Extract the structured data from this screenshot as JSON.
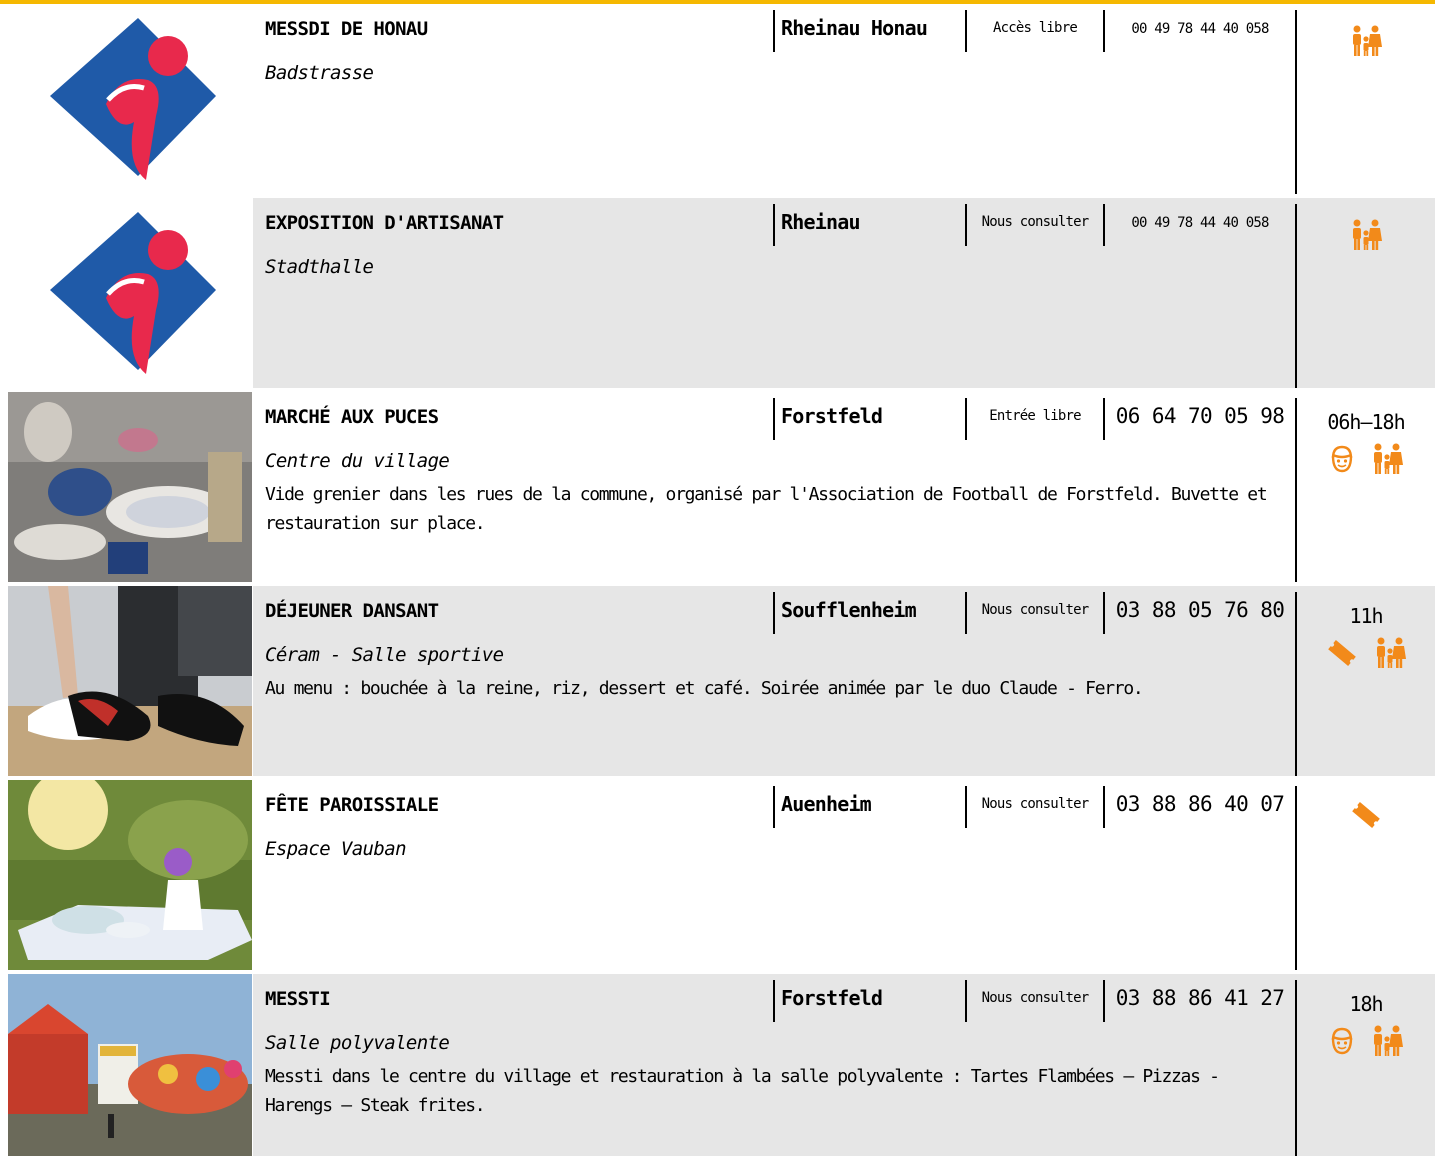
{
  "accent_color": "#f5b800",
  "icon_color": "#f28a1a",
  "events": [
    {
      "title": "MESSDI DE HONAU",
      "place": "Badstrasse",
      "city": "Rheinau Honau",
      "price": "Accès libre",
      "phone": "00 49 78 44 40 058",
      "time": "",
      "description": "",
      "image": "tourist-office-logo",
      "icons": [
        "family-icon"
      ]
    },
    {
      "title": "EXPOSITION D'ARTISANAT",
      "place": "Stadthalle",
      "city": "Rheinau",
      "price": "Nous consulter",
      "phone": "00 49 78 44 40 058",
      "time": "",
      "description": "",
      "image": "tourist-office-logo",
      "icons": [
        "family-icon"
      ]
    },
    {
      "title": "MARCHÉ AUX PUCES",
      "place": "Centre du village",
      "city": "Forstfeld",
      "price": "Entrée libre",
      "phone": "06 64 70 05 98",
      "time": "06h–18h",
      "description": "Vide grenier dans les rues de la commune, organisé par l'Association de Football de Forstfeld. Buvette et restauration sur place.",
      "image": "flea-market-photo",
      "icons": [
        "child-icon",
        "family-icon"
      ]
    },
    {
      "title": "DÉJEUNER DANSANT",
      "place": "Céram - Salle sportive",
      "city": "Soufflenheim",
      "price": "Nous consulter",
      "phone": "03 88 05 76 80",
      "time": "11h",
      "description": "Au menu : bouchée à la reine, riz, dessert et café. Soirée animée par le duo Claude - Ferro.",
      "image": "dance-shoes-photo",
      "icons": [
        "ticket-icon",
        "family-icon"
      ]
    },
    {
      "title": "FÊTE PAROISSIALE",
      "place": "Espace Vauban",
      "city": "Auenheim",
      "price": "Nous consulter",
      "phone": "03 88 86 40 07",
      "time": "",
      "description": "",
      "image": "garden-table-photo",
      "icons": [
        "ticket-icon"
      ]
    },
    {
      "title": "MESSTI",
      "place": "Salle polyvalente",
      "city": "Forstfeld",
      "price": "Nous consulter",
      "phone": "03 88 86 41 27",
      "time": "18h",
      "description": "Messti dans le centre du village et restauration à la salle polyvalente : Tartes Flambées – Pizzas - Harengs – Steak frites.",
      "image": "funfair-photo",
      "icons": [
        "child-icon",
        "family-icon"
      ]
    }
  ]
}
